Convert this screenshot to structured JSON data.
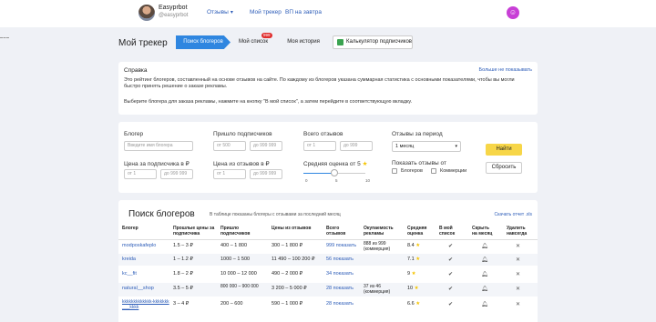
{
  "header": {
    "user_name": "Easyprbot",
    "user_handle": "@easyprbot",
    "nav": [
      {
        "label": "Отзывы"
      },
      {
        "label": "Мой трекер"
      },
      {
        "label": "ВП на завтра"
      }
    ],
    "profile_icon": "user-icon"
  },
  "page": {
    "title": "Мой трекер",
    "steps": [
      "Поиск блогеров",
      "Мой список",
      "Моя история"
    ],
    "badge": "999",
    "calc_button": "Калькулятор подписчиков"
  },
  "help": {
    "title": "Справка",
    "hide": "Больше не показывать",
    "text1": "Это рейтинг блогеров, составленный на основе отзывов на сайте. По каждому из блогеров указана суммарная статистика с основными показателями, чтобы вы могли быстро принять решение о заказе рекламы.",
    "text2": "Выберите блогера для заказа рекламы, нажмите на кнопку \"В мой список\", а затем перейдите в соответствующую вкладку."
  },
  "filters": {
    "blogger_label": "Блогер",
    "blogger_placeholder": "Введите имя блогера",
    "subs_label": "Пришло подписчиков",
    "subs_from": "от 500",
    "subs_to": "до 999 999",
    "reviews_label": "Всего отзывов",
    "reviews_from": "от 1",
    "reviews_to": "до 999",
    "period_label": "Отзывы за период",
    "period_value": "1 месяц",
    "price_label": "Цена за подписчика в ₽",
    "price_from": "от 1",
    "price_to": "до 999 999",
    "review_price_label": "Цена из отзывов в ₽",
    "review_price_from": "от 1",
    "review_price_to": "до 999 999",
    "rating_label": "Средняя оценка от 5",
    "rating_value": 5,
    "ticks": [
      "0",
      "5",
      "10"
    ],
    "show_label": "Показать отзывы от",
    "show_bloggers": "Блогеров",
    "show_commerce": "Коммерции",
    "find_button": "Найти",
    "reset_button": "Сбросить"
  },
  "search": {
    "title": "Поиск блогеров",
    "note": "В таблице показаны блогеры с отзывами за последний месяц",
    "download": "Скачать отчет .xls",
    "columns": [
      "Блогер",
      "Прошлые цены за подписчика",
      "Пришло подписчиков",
      "Цены из отзывов",
      "Всего отзывов",
      "Окупаемость рекламы",
      "Средняя оценка",
      "В мой список",
      "Скрыть на месяц",
      "Удалить навсегда"
    ],
    "rows": [
      {
        "blogger": "modposkafeplo",
        "past_price": "1.5 – 3 ₽",
        "subs": "400 – 1 800",
        "price": "300 – 1 800 ₽",
        "reviews": "999 показать",
        "roi": "888 из 999 (коммерция)",
        "rating": "8.4"
      },
      {
        "blogger": "kreida",
        "past_price": "1 – 1.2 ₽",
        "subs": "1000 – 1 500",
        "price": "11 490 – 100 200 ₽",
        "reviews": "56 показать",
        "roi": "",
        "rating": "7.1"
      },
      {
        "blogger": "kc__fit",
        "past_price": "1.8 – 2 ₽",
        "subs": "10 000 – 12 000",
        "price": "490 – 2 000 ₽",
        "reviews": "34 показать",
        "roi": "",
        "rating": "9"
      },
      {
        "blogger": "natural__shop",
        "past_price": "3.5 – 5 ₽",
        "subs": "800 000 – 900 000",
        "price": "3 200 – 5 000 ₽",
        "reviews": "28 показать",
        "roi": "37 из 46 (коммерция)",
        "rating": "10"
      },
      {
        "blogger": "kkkkkkkkkkkkk-kkkkkkk___kkkk",
        "past_price": "3 – 4 ₽",
        "subs": "200 – 600",
        "price": "590 – 1 000 ₽",
        "reviews": "28 показать",
        "roi": "",
        "rating": "6.6"
      }
    ]
  }
}
